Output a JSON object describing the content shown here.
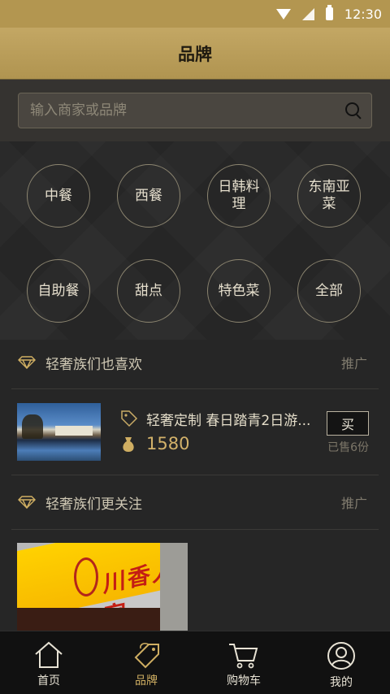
{
  "status_bar": {
    "time": "12:30"
  },
  "header": {
    "title": "品牌"
  },
  "search": {
    "placeholder": "输入商家或品牌"
  },
  "categories": [
    {
      "label": "中餐"
    },
    {
      "label": "西餐"
    },
    {
      "label": "日韩料理"
    },
    {
      "label": "东南亚菜"
    },
    {
      "label": "自助餐"
    },
    {
      "label": "甜点"
    },
    {
      "label": "特色菜"
    },
    {
      "label": "全部"
    }
  ],
  "section1": {
    "title": "轻奢族们也喜欢",
    "badge": "推广"
  },
  "product": {
    "title": "轻奢定制 春日踏青2日游...",
    "price": "1580",
    "buy_label": "买",
    "sold": "已售6份"
  },
  "section2": {
    "title": "轻奢族们更关注",
    "badge": "推广"
  },
  "banner": {
    "sign_text": "川香人家"
  },
  "nav": {
    "items": [
      {
        "label": "首页",
        "icon": "home-icon"
      },
      {
        "label": "品牌",
        "icon": "tag-icon"
      },
      {
        "label": "购物车",
        "icon": "cart-icon"
      },
      {
        "label": "我的",
        "icon": "user-icon"
      }
    ],
    "active_index": 1
  },
  "colors": {
    "accent_gold": "#b39650",
    "price_gold": "#d3b26a",
    "background": "#262626"
  }
}
